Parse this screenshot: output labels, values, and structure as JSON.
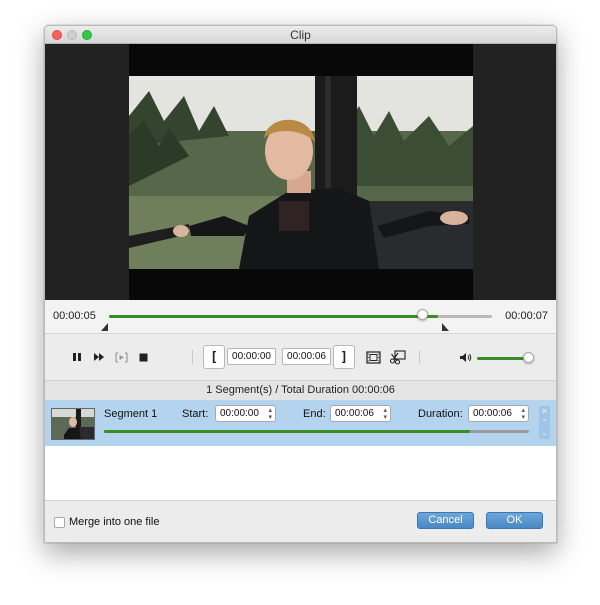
{
  "window": {
    "title": "Clip"
  },
  "timeline": {
    "current_time": "00:00:05",
    "total_time": "00:00:07",
    "progress_fraction": 0.82,
    "played_fraction": 0.86,
    "start_marker_fraction": 0.0,
    "end_marker_fraction": 0.87
  },
  "controls": {
    "buttons": [
      {
        "name": "pause-button",
        "icon": "pause-icon"
      },
      {
        "name": "next-frame-button",
        "icon": "next-frame-icon"
      },
      {
        "name": "trim-preview-button",
        "icon": "trim-preview-icon"
      },
      {
        "name": "stop-button",
        "icon": "stop-icon"
      }
    ],
    "set_start_glyph": "[",
    "start_time": "00:00:00",
    "end_time": "00:00:06",
    "set_end_glyph": "]",
    "volume_fraction": 1.0
  },
  "summary": {
    "text": "1 Segment(s) / Total Duration 00:00:06"
  },
  "segments": [
    {
      "name": "Segment 1",
      "start_label": "Start:",
      "start_value": "00:00:00",
      "end_label": "End:",
      "end_value": "00:00:06",
      "duration_label": "Duration:",
      "duration_value": "00:00:06",
      "progress_fraction": 0.86
    }
  ],
  "footer": {
    "merge_label": "Merge into one file",
    "merge_checked": false,
    "cancel_label": "Cancel",
    "ok_label": "OK"
  },
  "colors": {
    "accent_green": "#3a8d26",
    "selection_blue": "#b3d3ee",
    "button_blue": "#4a88c4"
  }
}
